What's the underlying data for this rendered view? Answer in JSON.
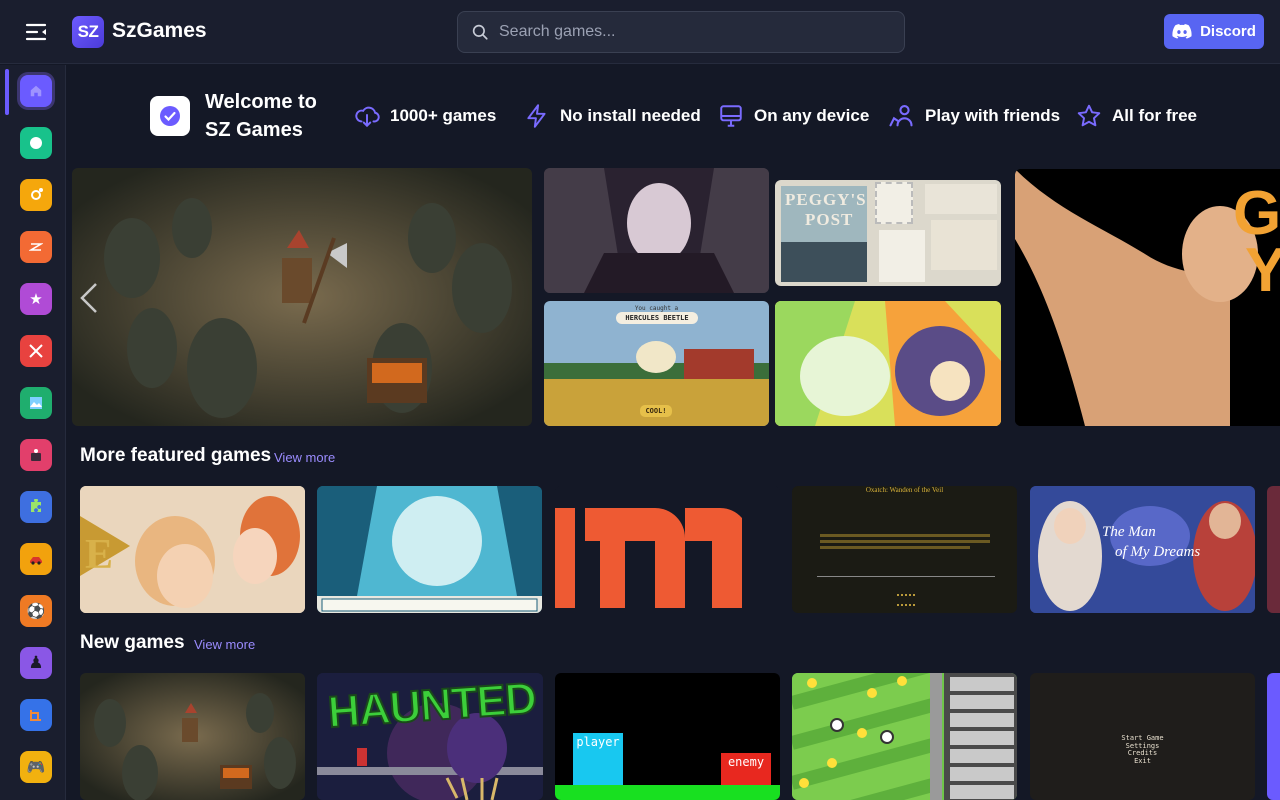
{
  "header": {
    "menu_icon": "menu-collapse-icon",
    "logo_text": "SZ",
    "brand": "SzGames",
    "search_placeholder": "Search games...",
    "discord_label": "Discord",
    "discord_color": "#5865f2"
  },
  "welcome": {
    "line1": "Welcome to",
    "line2": "SZ Games"
  },
  "features": [
    {
      "icon": "cloud-download-icon",
      "label": "1000+ games"
    },
    {
      "icon": "lightning-icon",
      "label": "No install needed"
    },
    {
      "icon": "monitor-icon",
      "label": "On any device"
    },
    {
      "icon": "users-icon",
      "label": "Play with friends"
    },
    {
      "icon": "star-icon",
      "label": "All for free"
    }
  ],
  "sidebar": {
    "items": [
      {
        "name": "home",
        "color": "#6b5bff"
      },
      {
        "name": "new",
        "color": "#18c28b"
      },
      {
        "name": "trending",
        "color": "#f5a70c"
      },
      {
        "name": "updated",
        "color": "#f36a34"
      },
      {
        "name": "originals",
        "color": "#b04bd6"
      },
      {
        "name": "action",
        "color": "#e8423f"
      },
      {
        "name": "adventure",
        "color": "#1fae6e"
      },
      {
        "name": "arcade",
        "color": "#e23f6b"
      },
      {
        "name": "puzzle",
        "color": "#3e6fe0"
      },
      {
        "name": "racing",
        "color": "#f2a20d"
      },
      {
        "name": "sports",
        "color": "#ef7a24"
      },
      {
        "name": "strategy",
        "color": "#8a57e6"
      },
      {
        "name": "building",
        "color": "#3572e8"
      },
      {
        "name": "controller",
        "color": "#f2b10f"
      }
    ]
  },
  "sections": {
    "featured_title": "More featured games",
    "featured_link": "View more",
    "new_title": "New games",
    "new_link": "View more"
  },
  "thumbs": {
    "peggy_title1": "PEGGY'S",
    "peggy_title2": "POST",
    "beetle_sub": "You caught a",
    "beetle_name": "HERCULES BEETLE",
    "beetle_btn": "COOL!",
    "haunted": "HAUNTED",
    "player": "player",
    "enemy": "enemy",
    "menu_lines": [
      "Start Game",
      "Settings",
      "Credits",
      "Exit"
    ],
    "oxatch_title": "Oxatch: Wanden of the Veil",
    "big_letters": "G\nY"
  },
  "colors": {
    "accent": "#6b5bff",
    "link": "#9b8cff",
    "bg": "#141826"
  }
}
